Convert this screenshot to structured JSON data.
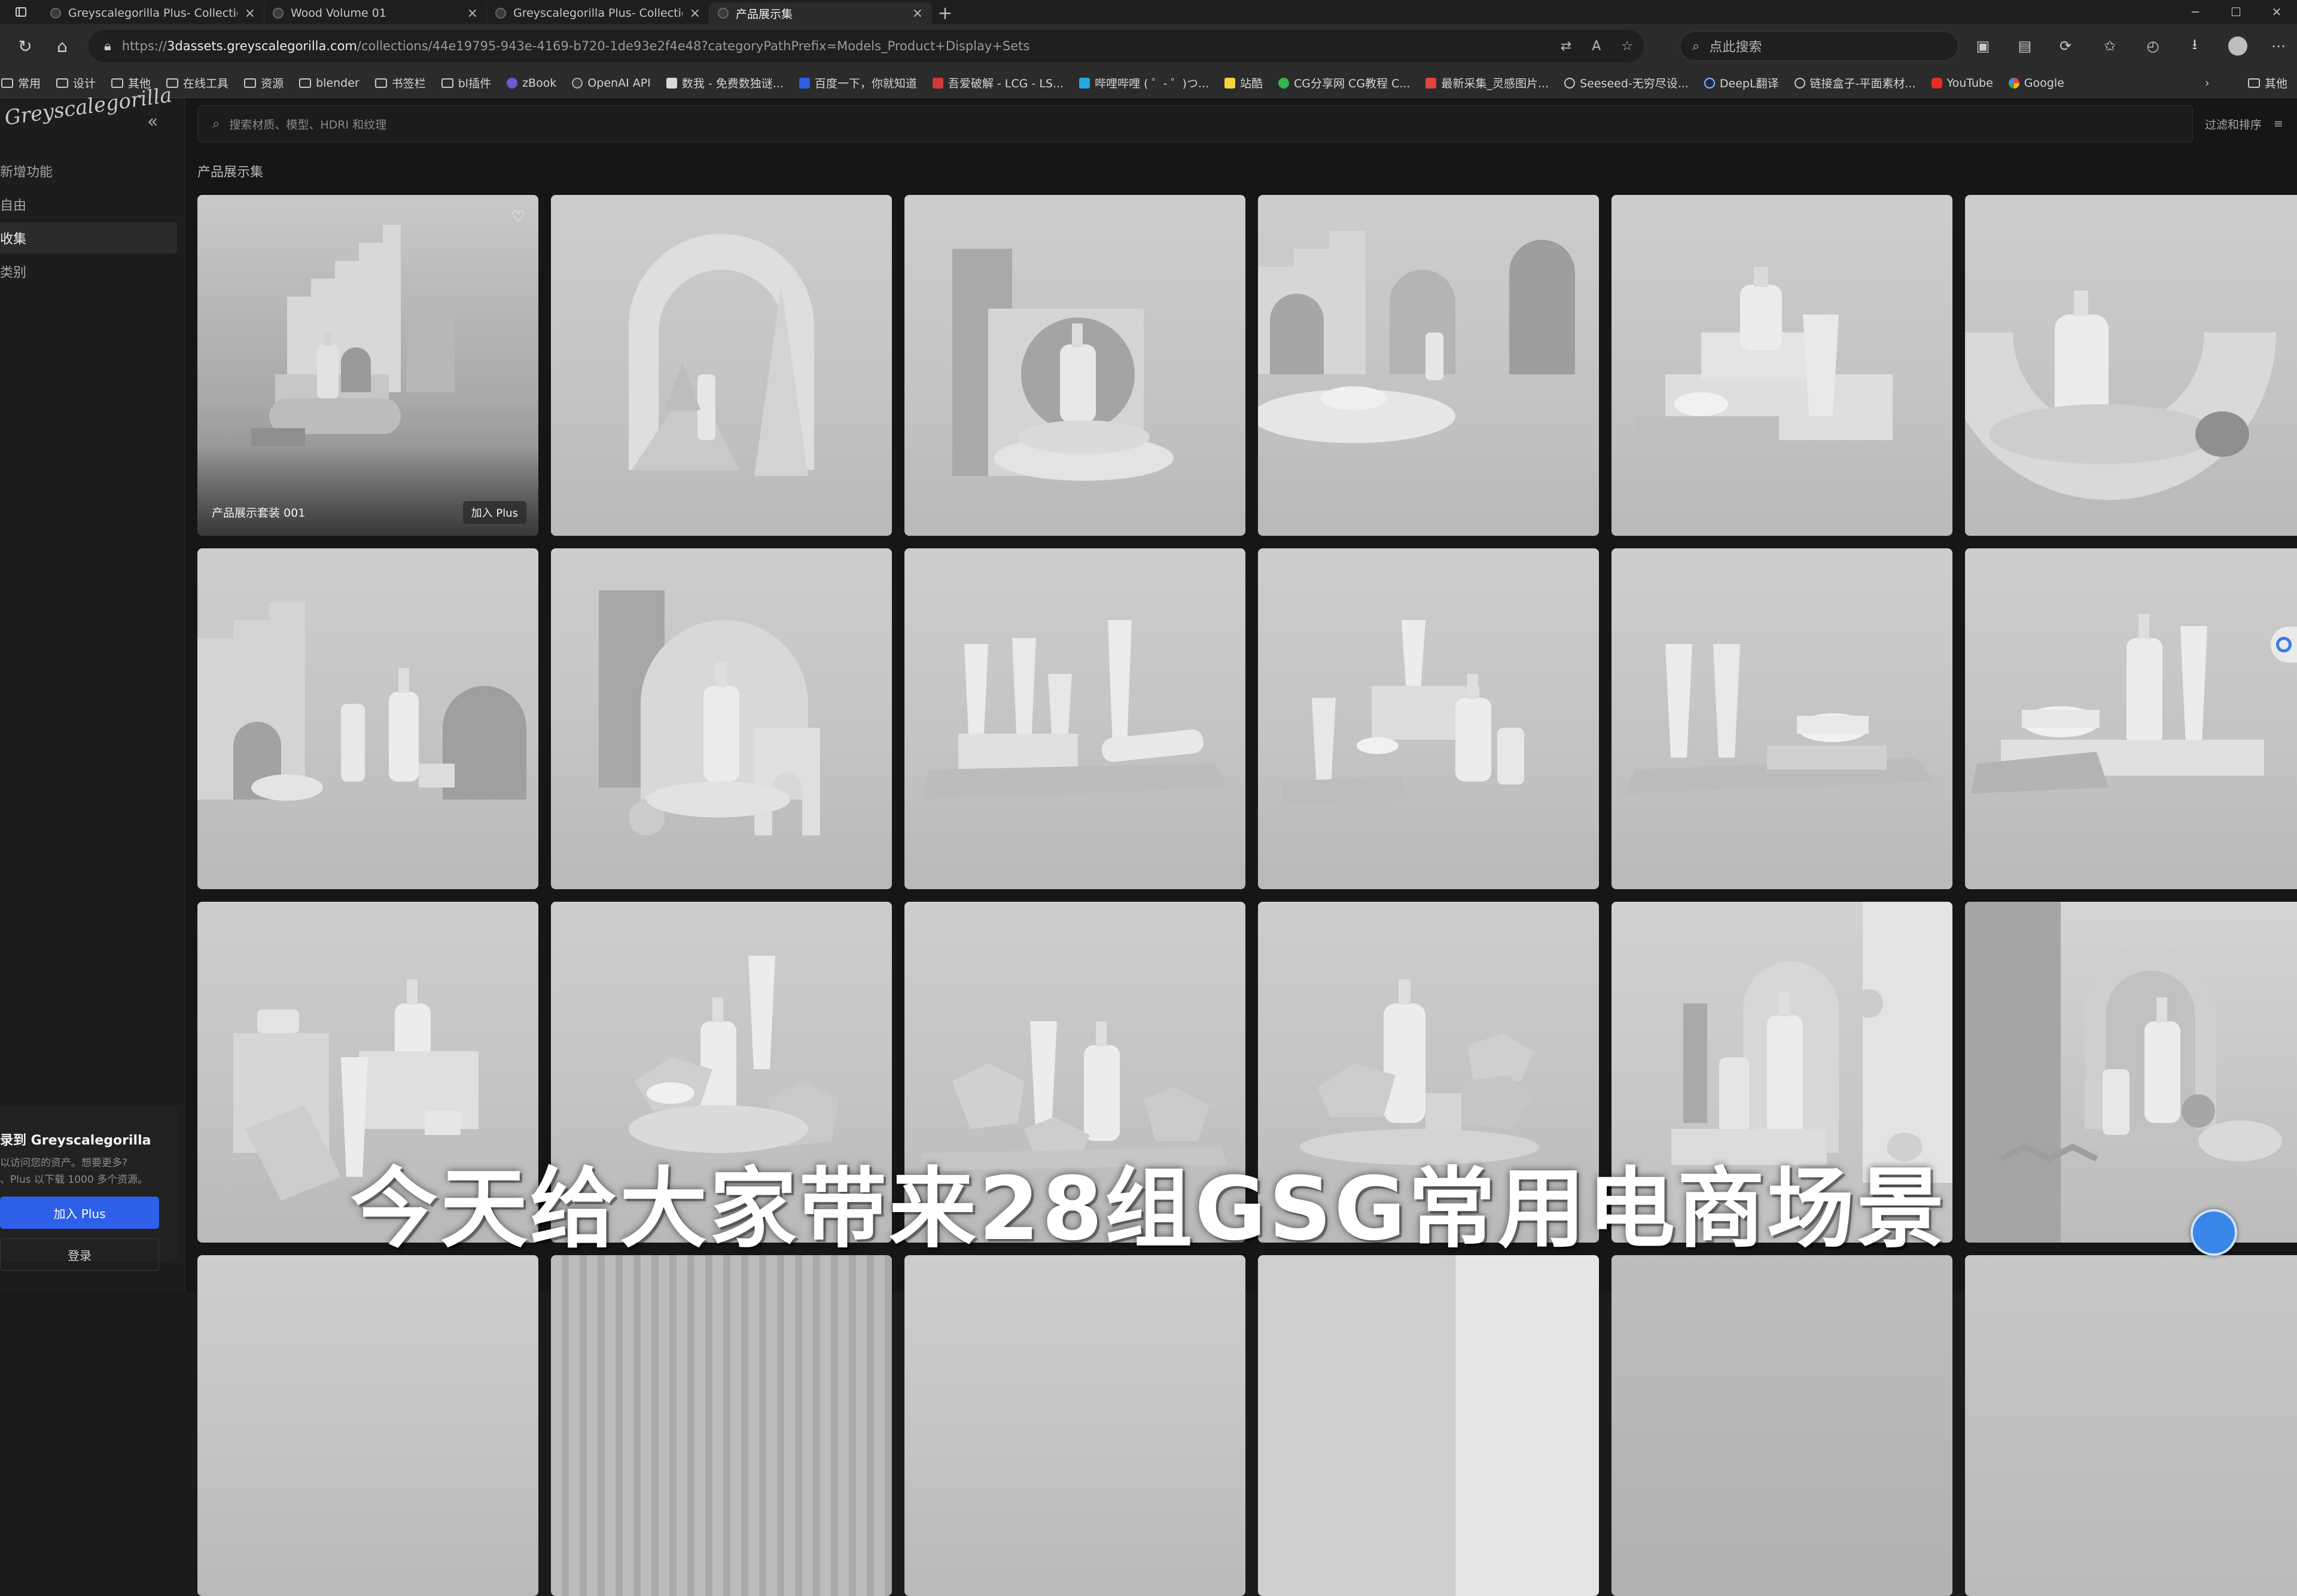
{
  "browser": {
    "tabs": [
      {
        "title": "Greyscalegorilla Plus- Collections",
        "active": false
      },
      {
        "title": "Wood Volume 01",
        "active": false
      },
      {
        "title": "Greyscalegorilla Plus- Collections",
        "active": false
      },
      {
        "title": "产品展示集",
        "active": true
      }
    ],
    "new_tab_icon": "+",
    "url_prefix": "https://",
    "url_host": "3dassets.greyscalegorilla.com",
    "url_path": "/collections/44e19795-943e-4169-b720-1de93e2f4e48?categoryPathPrefix=Models_Product+Display+Sets",
    "search_placeholder": "点此搜索"
  },
  "bookmarks": [
    {
      "label": "常用",
      "icon": "folder-icon"
    },
    {
      "label": "设计",
      "icon": "folder-icon"
    },
    {
      "label": "其他",
      "icon": "folder-icon"
    },
    {
      "label": "在线工具",
      "icon": "folder-icon"
    },
    {
      "label": "资源",
      "icon": "folder-icon"
    },
    {
      "label": "blender",
      "icon": "folder-icon"
    },
    {
      "label": "书签栏",
      "icon": "folder-icon"
    },
    {
      "label": "bl插件",
      "icon": "folder-icon"
    },
    {
      "label": "zBook",
      "icon": "site-icon"
    },
    {
      "label": "OpenAI API",
      "icon": "site-icon"
    },
    {
      "label": "数我 - 免费数独谜...",
      "icon": "site-icon"
    },
    {
      "label": "百度一下，你就知道",
      "icon": "site-icon"
    },
    {
      "label": "吾爱破解 - LCG - LS...",
      "icon": "site-icon"
    },
    {
      "label": "哔哩哔哩 ( ゜- ゜)つ...",
      "icon": "site-icon"
    },
    {
      "label": "站酷",
      "icon": "site-icon"
    },
    {
      "label": "CG分享网 CG教程 C...",
      "icon": "site-icon"
    },
    {
      "label": "最新采集_灵感图片...",
      "icon": "site-icon"
    },
    {
      "label": "Seeseed-无穷尽设...",
      "icon": "globe-icon"
    },
    {
      "label": "DeepL翻译",
      "icon": "site-icon"
    },
    {
      "label": "链接盒子-平面素材...",
      "icon": "globe-icon"
    },
    {
      "label": "YouTube",
      "icon": "site-icon"
    },
    {
      "label": "Google",
      "icon": "site-icon"
    }
  ],
  "bookmarks_overflow": "其他",
  "sidebar": {
    "logo_text": "Greyscalegorilla",
    "items": [
      {
        "label": "新增功能",
        "active": false
      },
      {
        "label": "自由",
        "active": false
      },
      {
        "label": "收集",
        "active": true
      },
      {
        "label": "类别",
        "active": false
      }
    ],
    "promo": {
      "title": "录到 Greyscalegorilla",
      "desc_line1": "以访问您的资产。想要更多?",
      "desc_line2": "、Plus 以下载 1000 多个资源。",
      "join_label": "加入 Plus",
      "login_label": "登录"
    }
  },
  "main": {
    "search_placeholder": "搜索材质、模型、HDRI 和纹理",
    "filter_label": "过滤和排序",
    "section_title": "产品展示集",
    "first_card": {
      "name": "产品展示套装 001",
      "join_label": "加入 Plus"
    },
    "card_count_visible": 18
  },
  "overlay_subtitle": "今天给大家带来28组GSG常用电商场景",
  "colors": {
    "accent_blue": "#2d5fe7",
    "page_bg": "#161616",
    "card_bg": "#c6c6c6"
  }
}
